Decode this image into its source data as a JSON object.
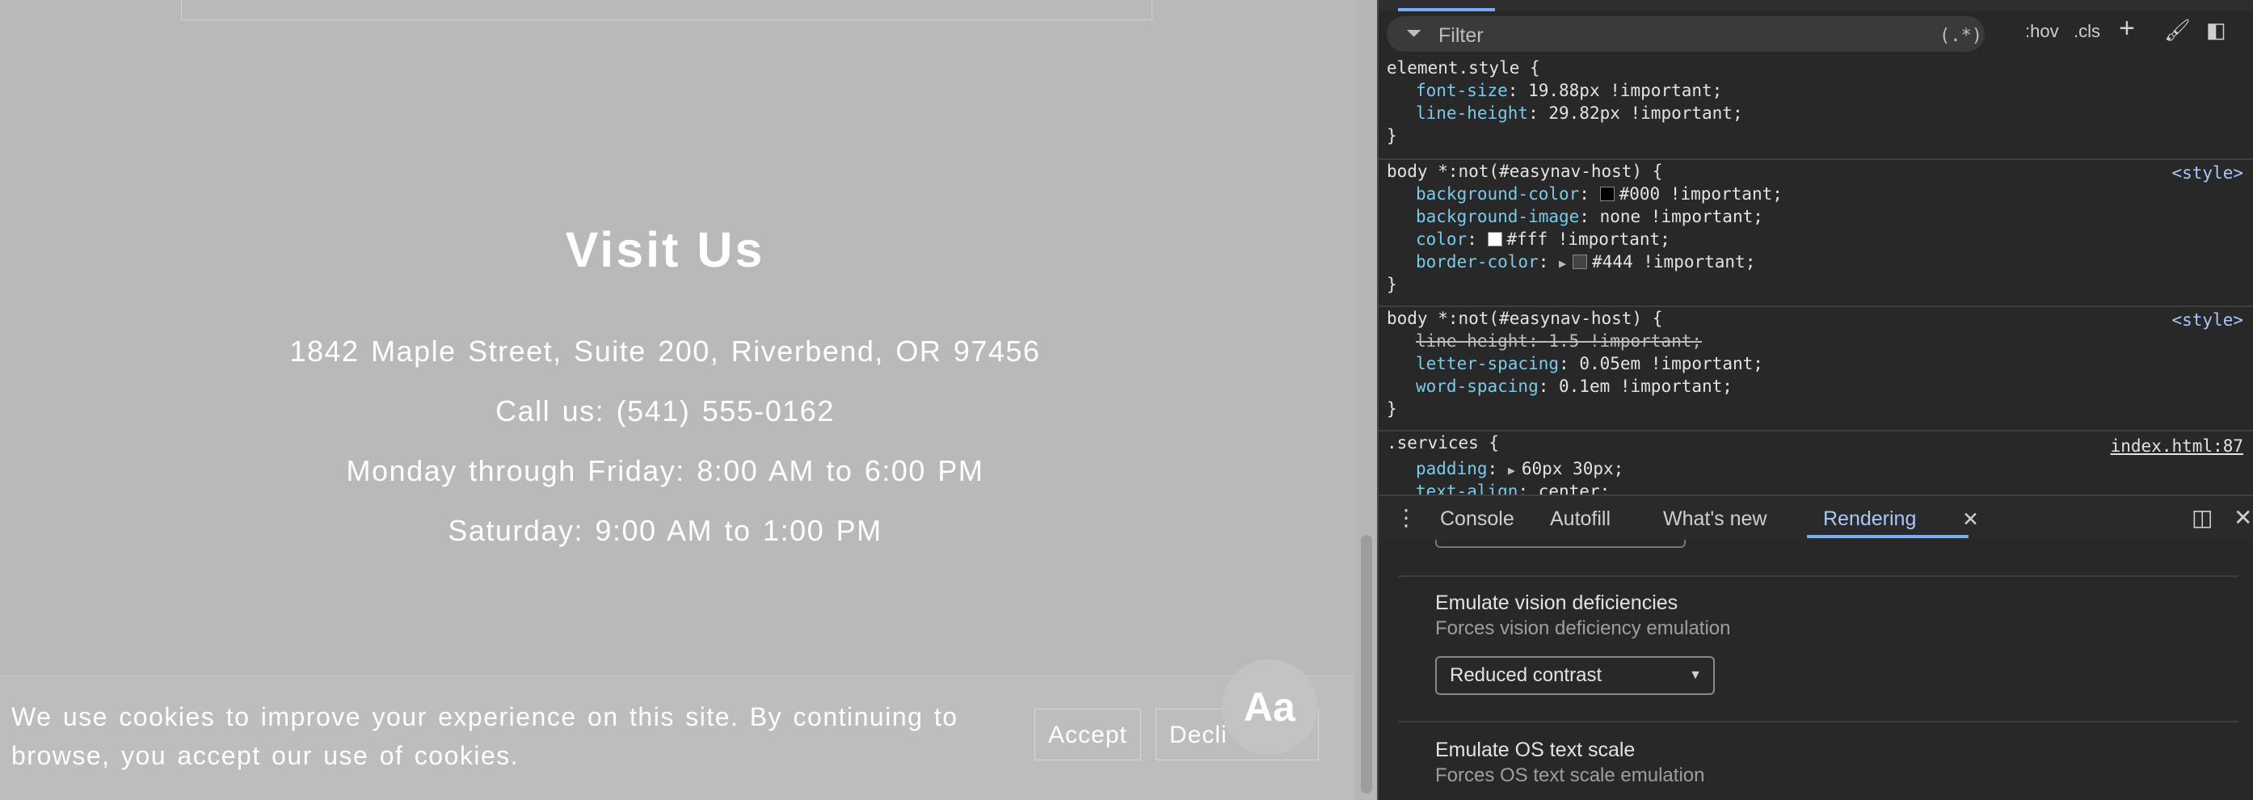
{
  "page": {
    "visit_title": "Visit Us",
    "address": "1842 Maple Street, Suite 200, Riverbend, OR 97456",
    "phone": "Call us: (541) 555-0162",
    "weekday_hours": "Monday through Friday: 8:00 AM to 6:00 PM",
    "saturday_hours": "Saturday: 9:00 AM to 1:00 PM",
    "cookie_text": "We use cookies to improve your experience on this site. By continuing to browse, you accept our use of cookies.",
    "accept_label": "Accept",
    "decline_label": "Decli",
    "aa_label": "Aa"
  },
  "devtools": {
    "filter": {
      "placeholder": "Filter",
      "regex": "(.*)",
      "hov": ":hov",
      "cls": ".cls"
    },
    "rules": [
      {
        "selector": "element.style {",
        "source": "",
        "decls": [
          {
            "prop": "font-size",
            "value": "19.88px !important;"
          },
          {
            "prop": "line-height",
            "value": "29.82px !important;"
          }
        ]
      },
      {
        "selector": "body *:not(#easynav-host) {",
        "source": "<style>",
        "decls": [
          {
            "prop": "background-color",
            "value": "#000 !important;",
            "swatch": "#000000"
          },
          {
            "prop": "background-image",
            "value": "none !important;"
          },
          {
            "prop": "color",
            "value": "#fff !important;",
            "swatch": "#ffffff"
          },
          {
            "prop": "border-color",
            "value": "#444 !important;",
            "swatch": "#444444"
          }
        ]
      },
      {
        "selector": "body *:not(#easynav-host) {",
        "source": "<style>",
        "decls": [
          {
            "prop": "line-height",
            "value": "1.5 !important;"
          },
          {
            "prop": "letter-spacing",
            "value": "0.05em !important;"
          },
          {
            "prop": "word-spacing",
            "value": "0.1em !important;"
          }
        ]
      },
      {
        "selector": ".services {",
        "source": "index.html:87",
        "decls": [
          {
            "prop": "padding",
            "value": "60px 30px;"
          },
          {
            "prop": "text-align",
            "value": "center;"
          }
        ]
      }
    ],
    "closing_brace": "}",
    "colon": ": ",
    "drawer_tabs": [
      "Console",
      "Autofill",
      "What's new",
      "Rendering"
    ],
    "rendering": {
      "vision_title": "Emulate vision deficiencies",
      "vision_desc": "Forces vision deficiency emulation",
      "vision_selected": "Reduced contrast",
      "text_scale_title": "Emulate OS text scale",
      "text_scale_desc": "Forces OS text scale emulation"
    },
    "icons": [
      "filter-icon",
      "plus-icon",
      "paint-brush-icon",
      "sidebar-toggle-icon",
      "kebab-menu-icon",
      "close-icon",
      "dock-side-icon",
      "chevron-down-icon"
    ]
  }
}
